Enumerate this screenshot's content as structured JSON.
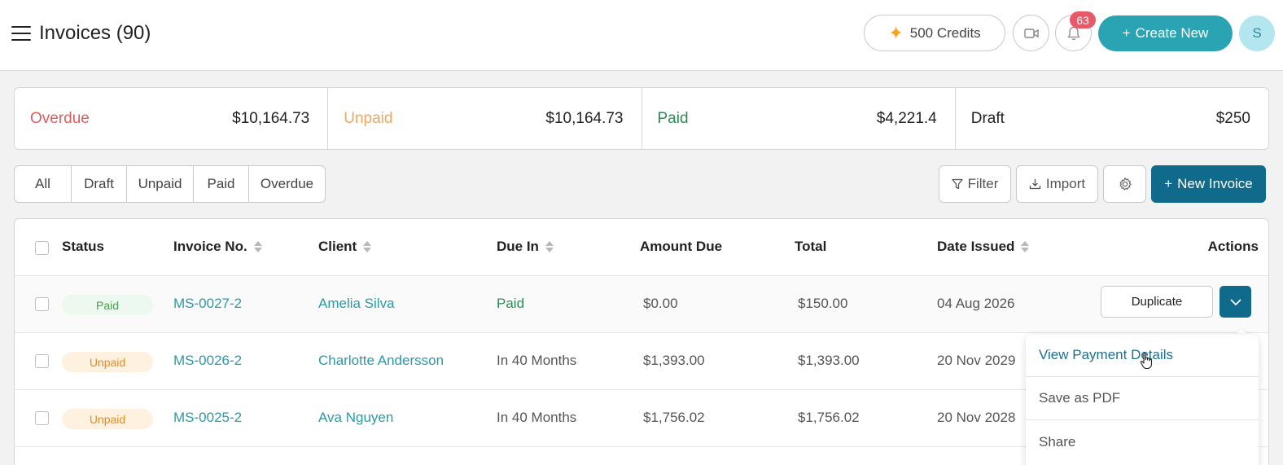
{
  "header": {
    "title": "Invoices (90)",
    "credits_label": "500 Credits",
    "notification_count": "63",
    "create_label": "Create New",
    "avatar_initial": "S"
  },
  "summary": [
    {
      "label": "Overdue",
      "value": "$10,164.73",
      "color": "#e05d5d"
    },
    {
      "label": "Unpaid",
      "value": "$10,164.73",
      "color": "#f0a860"
    },
    {
      "label": "Paid",
      "value": "$4,221.4",
      "color": "#2e8b57"
    },
    {
      "label": "Draft",
      "value": "$250",
      "color": "#222222"
    }
  ],
  "tabs": [
    "All",
    "Draft",
    "Unpaid",
    "Paid",
    "Overdue"
  ],
  "toolbar": {
    "filter_label": "Filter",
    "import_label": "Import",
    "new_invoice_label": "New Invoice"
  },
  "table": {
    "columns": [
      "Status",
      "Invoice No.",
      "Client",
      "Due In",
      "Amount Due",
      "Total",
      "Date Issued",
      "Actions"
    ],
    "rows": [
      {
        "status": "Paid",
        "invoice": "MS-0027-2",
        "client": "Amelia Silva",
        "due": "Paid",
        "amount_due": "$0.00",
        "total": "$150.00",
        "date": "04 Aug 2026"
      },
      {
        "status": "Unpaid",
        "invoice": "MS-0026-2",
        "client": "Charlotte Andersson",
        "due": "In 40 Months",
        "amount_due": "$1,393.00",
        "total": "$1,393.00",
        "date": "20 Nov 2029"
      },
      {
        "status": "Unpaid",
        "invoice": "MS-0025-2",
        "client": "Ava Nguyen",
        "due": "In 40 Months",
        "amount_due": "$1,756.02",
        "total": "$1,756.02",
        "date": "20 Nov 2028"
      }
    ],
    "duplicate_label": "Duplicate"
  },
  "dropdown": {
    "items": [
      "View Payment Details",
      "Save as PDF",
      "Share"
    ]
  },
  "colors": {
    "accent": "#2aa3b3",
    "primary": "#0f6a8c"
  }
}
